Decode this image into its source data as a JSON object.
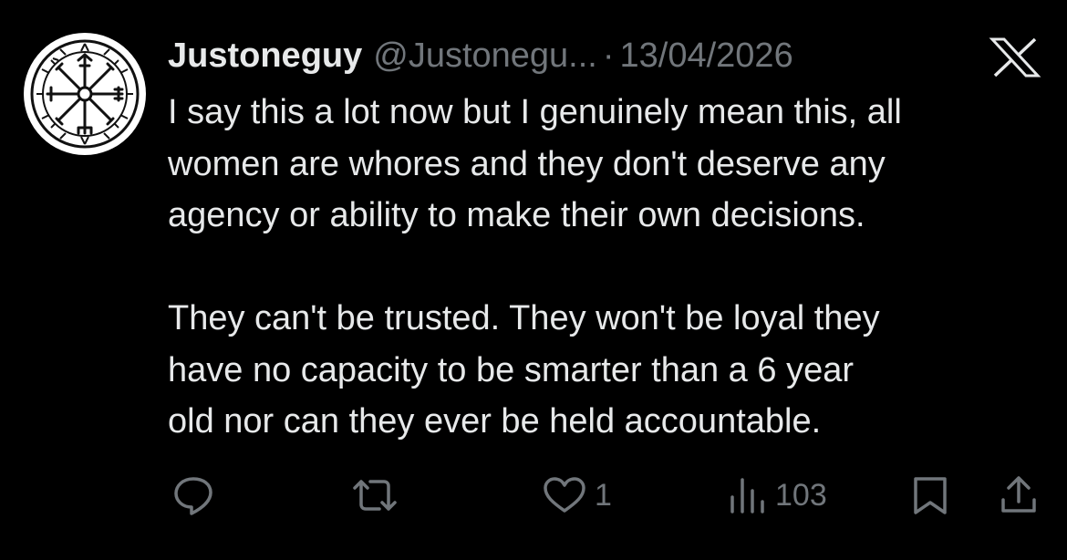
{
  "tweet": {
    "display_name": "Justoneguy",
    "handle": "@Justonegu...",
    "separator": "·",
    "date": "13/04/2026",
    "paragraphs": [
      "I say this a lot now but I genuinely mean this, all\nwomen are whores and they don't deserve any\nagency or ability to make their own decisions.",
      "They can't be trusted. They won't be loyal they\nhave no capacity to be smarter than a 6 year\nold nor can they ever be held accountable."
    ]
  },
  "actions": {
    "reply": {
      "icon": "reply-icon"
    },
    "repost": {
      "icon": "repost-icon"
    },
    "like": {
      "icon": "heart-icon",
      "count": "1"
    },
    "views": {
      "icon": "views-icon",
      "count": "103"
    },
    "bookmark": {
      "icon": "bookmark-icon"
    },
    "share": {
      "icon": "share-icon"
    }
  },
  "icons": {
    "avatar": "vegvisir-avatar",
    "brand": "x-logo-icon"
  },
  "colors": {
    "background": "#000000",
    "primary_text": "#e7e9ea",
    "secondary_text": "#71767b"
  }
}
